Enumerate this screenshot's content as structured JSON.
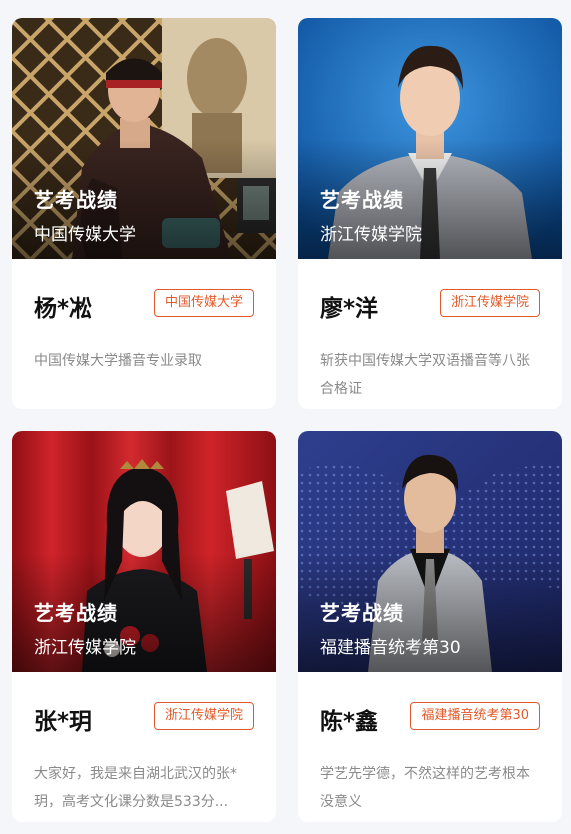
{
  "cards": [
    {
      "photo_title": "艺考战绩",
      "photo_school": "中国传媒大学",
      "name": "杨*凇",
      "tag": "中国传媒大学",
      "description": "中国传媒大学播音专业录取"
    },
    {
      "photo_title": "艺考战绩",
      "photo_school": "浙江传媒学院",
      "name": "廖*洋",
      "tag": "浙江传媒学院",
      "description": "斩获中国传媒大学双语播音等八张合格证"
    },
    {
      "photo_title": "艺考战绩",
      "photo_school": "浙江传媒学院",
      "name": "张*玥",
      "tag": "浙江传媒学院",
      "description": "大家好，我是来自湖北武汉的张*玥，高考文化课分数是533分..."
    },
    {
      "photo_title": "艺考战绩",
      "photo_school": "福建播音统考第30",
      "name": "陈*鑫",
      "tag": "福建播音统考第30",
      "description": "学艺先学德，不然这样的艺考根本没意义"
    }
  ],
  "colors": {
    "accent": "#e35a2a",
    "page_bg": "#f5f6fa"
  }
}
